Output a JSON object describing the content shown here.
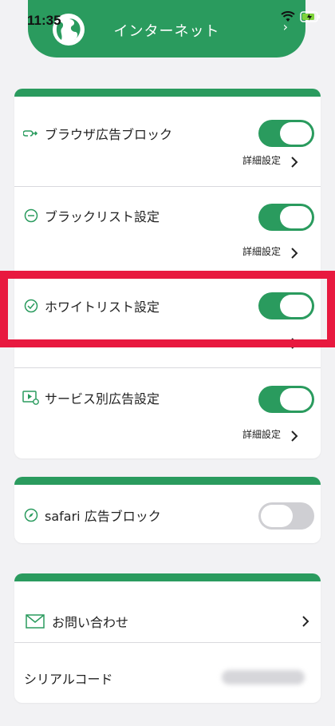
{
  "status": {
    "time": "11:35"
  },
  "header": {
    "title": "インターネット"
  },
  "settings": {
    "browser_ad_block": {
      "label": "ブラウザ広告ブロック",
      "detail": "詳細設定",
      "on": true
    },
    "blacklist": {
      "label": "ブラックリスト設定",
      "detail": "詳細設定",
      "on": true
    },
    "whitelist": {
      "label": "ホワイトリスト設定",
      "on": true
    },
    "service_ad": {
      "label": "サービス別広告設定",
      "detail": "詳細設定",
      "on": true
    }
  },
  "safari": {
    "label": "safari 広告ブロック",
    "on": false
  },
  "support": {
    "contact_label": "お問い合わせ",
    "serial_label": "シリアルコード"
  },
  "colors": {
    "accent": "#2a9b5e",
    "highlight": "#e8193f",
    "toggle_off": "#cfcfd3"
  }
}
